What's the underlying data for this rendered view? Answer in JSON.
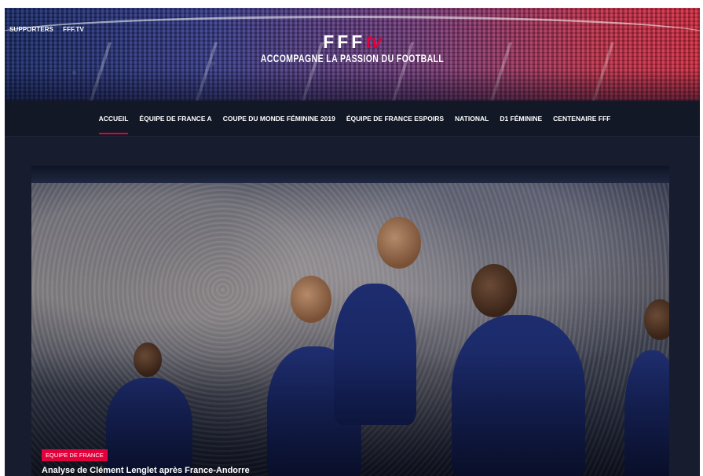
{
  "header": {
    "top_links": [
      "SUPPORTERS",
      "FFF.TV"
    ],
    "logo_text": "FFF",
    "logo_suffix": "tv",
    "tagline": "ACCOMPAGNE LA PASSION DU FOOTBALL"
  },
  "nav": {
    "items": [
      {
        "label": "ACCUEIL",
        "active": true
      },
      {
        "label": "ÉQUIPE DE FRANCE A",
        "active": false
      },
      {
        "label": "COUPE DU MONDE FÉMININE 2019",
        "active": false
      },
      {
        "label": "ÉQUIPE DE FRANCE ESPOIRS",
        "active": false
      },
      {
        "label": "NATIONAL",
        "active": false
      },
      {
        "label": "D1 FÉMININE",
        "active": false
      },
      {
        "label": "CENTENAIRE FFF",
        "active": false
      }
    ]
  },
  "hero": {
    "category": "EQUIPE DE FRANCE",
    "title": "Analyse de Clément Lenglet après France-Andorre"
  },
  "colors": {
    "accent": "#e1003c",
    "background": "#14192a"
  }
}
